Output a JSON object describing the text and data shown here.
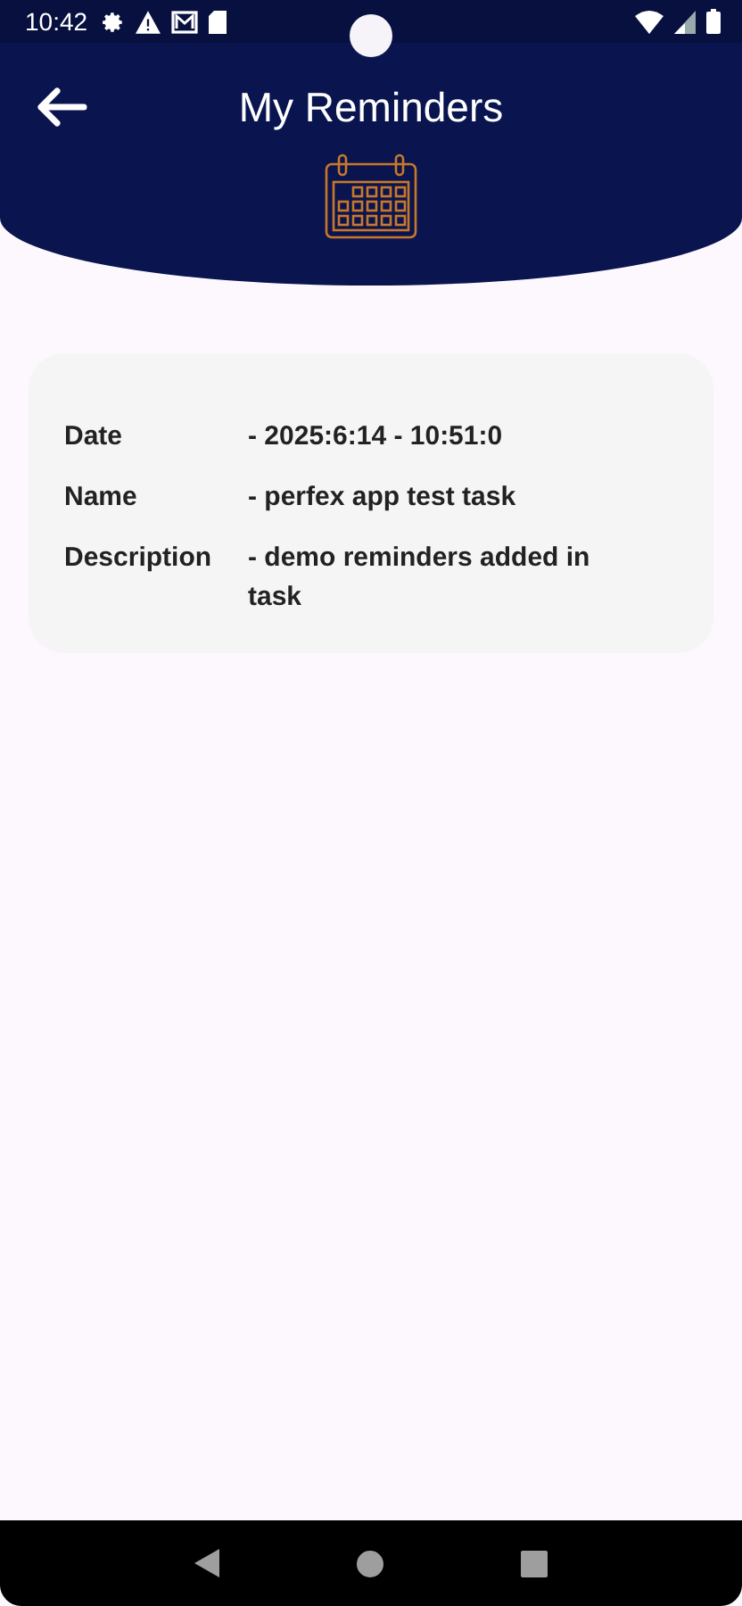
{
  "status_bar": {
    "time": "10:42"
  },
  "header": {
    "title": "My Reminders"
  },
  "reminders": [
    {
      "rows": [
        {
          "label": "Date",
          "value": "- 2025:6:14 - 10:51:0"
        },
        {
          "label": "Name",
          "value": "- perfex app test task"
        },
        {
          "label": "Description",
          "value": "- demo reminders added in task"
        }
      ]
    }
  ]
}
